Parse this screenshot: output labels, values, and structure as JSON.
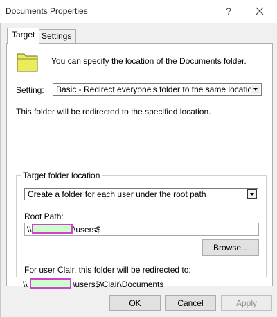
{
  "window": {
    "title": "Documents Properties",
    "help_label": "?",
    "close_icon": "close-icon"
  },
  "tabs": [
    {
      "label": "Target",
      "selected": true
    },
    {
      "label": "Settings",
      "selected": false
    }
  ],
  "target": {
    "folder_icon": "folder-icon",
    "folder_icon_color": "#ecec5a",
    "info_text": "You can specify the location of the Documents folder.",
    "setting_label": "Setting:",
    "setting_value": "Basic - Redirect everyone's folder to the same location",
    "redirect_text": "This folder will be redirected to the specified location.",
    "group_title": "Target folder location",
    "location_value": "Create a folder for each user under the root path",
    "root_path_label": "Root Path:",
    "root_path_prefix": "\\\\",
    "root_path_suffix": "\\users$",
    "browse_label": "Browse...",
    "for_user_text": "For user Clair, this folder will be redirected to:",
    "final_prefix": "\\\\",
    "final_suffix": "\\users$\\Clair\\Documents",
    "redaction_fill": "#ccffcc",
    "redaction_border": "#cc44cc"
  },
  "buttons": {
    "ok": "OK",
    "cancel": "Cancel",
    "apply": "Apply"
  }
}
